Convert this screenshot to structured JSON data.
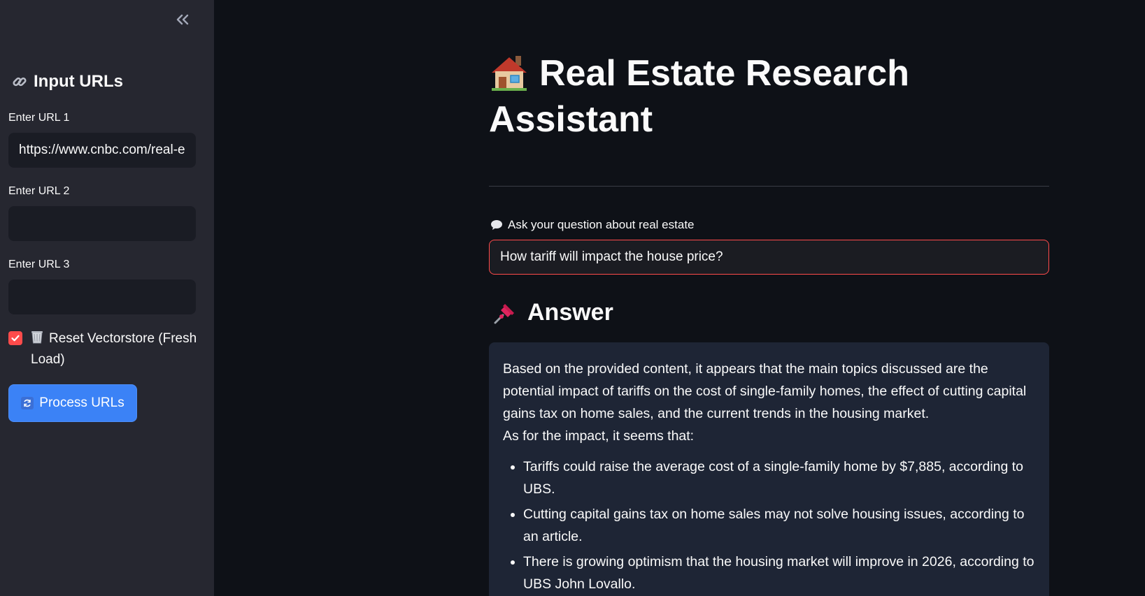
{
  "sidebar": {
    "title": "Input URLs",
    "url_fields": [
      {
        "label": "Enter URL 1",
        "value": "https://www.cnbc.com/real-e",
        "placeholder": ""
      },
      {
        "label": "Enter URL 2",
        "value": "",
        "placeholder": ""
      },
      {
        "label": "Enter URL 3",
        "value": "",
        "placeholder": ""
      }
    ],
    "reset_checkbox": {
      "label": "Reset Vectorstore (Fresh Load)",
      "checked": true
    },
    "process_button": "Process URLs"
  },
  "main": {
    "title": "Real Estate Research Assistant",
    "question_label": "Ask your question about real estate",
    "question_value": "How tariff will impact the house price?",
    "answer_heading": "Answer",
    "answer": {
      "intro": "Based on the provided content, it appears that the main topics discussed are the potential impact of tariffs on the cost of single-family homes, the effect of cutting capital gains tax on home sales, and the current trends in the housing market.",
      "lead": "As for the impact, it seems that:",
      "bullets": [
        "Tariffs could raise the average cost of a single-family home by $7,885, according to UBS.",
        "Cutting capital gains tax on home sales may not solve housing issues, according to an article.",
        "There is growing optimism that the housing market will improve in 2026, according to UBS John Lovallo."
      ]
    }
  },
  "colors": {
    "app_background": "#0e1117",
    "sidebar_background": "#262730",
    "accent_red": "#ff4b4b",
    "button_blue": "#3b82f6",
    "answer_background": "#1e2535"
  },
  "icons": {
    "collapse": "double-chevron-left-icon",
    "link": "link-icon",
    "trash": "wastebasket-icon",
    "sync": "sync-icon",
    "house": "house-icon",
    "speech": "speech-bubble-icon",
    "pushpin": "pushpin-icon",
    "check": "checkmark-icon"
  }
}
